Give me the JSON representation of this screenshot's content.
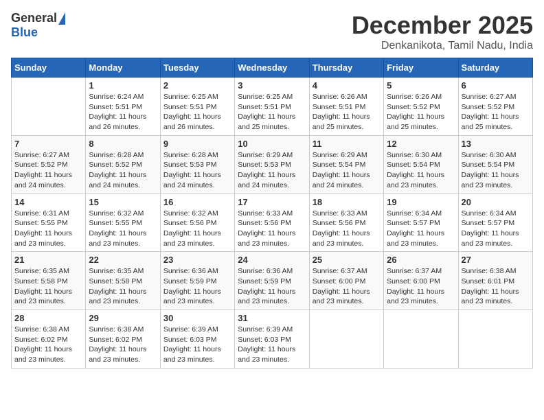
{
  "header": {
    "logo_general": "General",
    "logo_blue": "Blue",
    "month_title": "December 2025",
    "subtitle": "Denkanikota, Tamil Nadu, India"
  },
  "weekdays": [
    "Sunday",
    "Monday",
    "Tuesday",
    "Wednesday",
    "Thursday",
    "Friday",
    "Saturday"
  ],
  "weeks": [
    [
      {
        "day": "",
        "sunrise": "",
        "sunset": "",
        "daylight": ""
      },
      {
        "day": "1",
        "sunrise": "Sunrise: 6:24 AM",
        "sunset": "Sunset: 5:51 PM",
        "daylight": "Daylight: 11 hours and 26 minutes."
      },
      {
        "day": "2",
        "sunrise": "Sunrise: 6:25 AM",
        "sunset": "Sunset: 5:51 PM",
        "daylight": "Daylight: 11 hours and 26 minutes."
      },
      {
        "day": "3",
        "sunrise": "Sunrise: 6:25 AM",
        "sunset": "Sunset: 5:51 PM",
        "daylight": "Daylight: 11 hours and 25 minutes."
      },
      {
        "day": "4",
        "sunrise": "Sunrise: 6:26 AM",
        "sunset": "Sunset: 5:51 PM",
        "daylight": "Daylight: 11 hours and 25 minutes."
      },
      {
        "day": "5",
        "sunrise": "Sunrise: 6:26 AM",
        "sunset": "Sunset: 5:52 PM",
        "daylight": "Daylight: 11 hours and 25 minutes."
      },
      {
        "day": "6",
        "sunrise": "Sunrise: 6:27 AM",
        "sunset": "Sunset: 5:52 PM",
        "daylight": "Daylight: 11 hours and 25 minutes."
      }
    ],
    [
      {
        "day": "7",
        "sunrise": "Sunrise: 6:27 AM",
        "sunset": "Sunset: 5:52 PM",
        "daylight": "Daylight: 11 hours and 24 minutes."
      },
      {
        "day": "8",
        "sunrise": "Sunrise: 6:28 AM",
        "sunset": "Sunset: 5:52 PM",
        "daylight": "Daylight: 11 hours and 24 minutes."
      },
      {
        "day": "9",
        "sunrise": "Sunrise: 6:28 AM",
        "sunset": "Sunset: 5:53 PM",
        "daylight": "Daylight: 11 hours and 24 minutes."
      },
      {
        "day": "10",
        "sunrise": "Sunrise: 6:29 AM",
        "sunset": "Sunset: 5:53 PM",
        "daylight": "Daylight: 11 hours and 24 minutes."
      },
      {
        "day": "11",
        "sunrise": "Sunrise: 6:29 AM",
        "sunset": "Sunset: 5:54 PM",
        "daylight": "Daylight: 11 hours and 24 minutes."
      },
      {
        "day": "12",
        "sunrise": "Sunrise: 6:30 AM",
        "sunset": "Sunset: 5:54 PM",
        "daylight": "Daylight: 11 hours and 23 minutes."
      },
      {
        "day": "13",
        "sunrise": "Sunrise: 6:30 AM",
        "sunset": "Sunset: 5:54 PM",
        "daylight": "Daylight: 11 hours and 23 minutes."
      }
    ],
    [
      {
        "day": "14",
        "sunrise": "Sunrise: 6:31 AM",
        "sunset": "Sunset: 5:55 PM",
        "daylight": "Daylight: 11 hours and 23 minutes."
      },
      {
        "day": "15",
        "sunrise": "Sunrise: 6:32 AM",
        "sunset": "Sunset: 5:55 PM",
        "daylight": "Daylight: 11 hours and 23 minutes."
      },
      {
        "day": "16",
        "sunrise": "Sunrise: 6:32 AM",
        "sunset": "Sunset: 5:56 PM",
        "daylight": "Daylight: 11 hours and 23 minutes."
      },
      {
        "day": "17",
        "sunrise": "Sunrise: 6:33 AM",
        "sunset": "Sunset: 5:56 PM",
        "daylight": "Daylight: 11 hours and 23 minutes."
      },
      {
        "day": "18",
        "sunrise": "Sunrise: 6:33 AM",
        "sunset": "Sunset: 5:56 PM",
        "daylight": "Daylight: 11 hours and 23 minutes."
      },
      {
        "day": "19",
        "sunrise": "Sunrise: 6:34 AM",
        "sunset": "Sunset: 5:57 PM",
        "daylight": "Daylight: 11 hours and 23 minutes."
      },
      {
        "day": "20",
        "sunrise": "Sunrise: 6:34 AM",
        "sunset": "Sunset: 5:57 PM",
        "daylight": "Daylight: 11 hours and 23 minutes."
      }
    ],
    [
      {
        "day": "21",
        "sunrise": "Sunrise: 6:35 AM",
        "sunset": "Sunset: 5:58 PM",
        "daylight": "Daylight: 11 hours and 23 minutes."
      },
      {
        "day": "22",
        "sunrise": "Sunrise: 6:35 AM",
        "sunset": "Sunset: 5:58 PM",
        "daylight": "Daylight: 11 hours and 23 minutes."
      },
      {
        "day": "23",
        "sunrise": "Sunrise: 6:36 AM",
        "sunset": "Sunset: 5:59 PM",
        "daylight": "Daylight: 11 hours and 23 minutes."
      },
      {
        "day": "24",
        "sunrise": "Sunrise: 6:36 AM",
        "sunset": "Sunset: 5:59 PM",
        "daylight": "Daylight: 11 hours and 23 minutes."
      },
      {
        "day": "25",
        "sunrise": "Sunrise: 6:37 AM",
        "sunset": "Sunset: 6:00 PM",
        "daylight": "Daylight: 11 hours and 23 minutes."
      },
      {
        "day": "26",
        "sunrise": "Sunrise: 6:37 AM",
        "sunset": "Sunset: 6:00 PM",
        "daylight": "Daylight: 11 hours and 23 minutes."
      },
      {
        "day": "27",
        "sunrise": "Sunrise: 6:38 AM",
        "sunset": "Sunset: 6:01 PM",
        "daylight": "Daylight: 11 hours and 23 minutes."
      }
    ],
    [
      {
        "day": "28",
        "sunrise": "Sunrise: 6:38 AM",
        "sunset": "Sunset: 6:02 PM",
        "daylight": "Daylight: 11 hours and 23 minutes."
      },
      {
        "day": "29",
        "sunrise": "Sunrise: 6:38 AM",
        "sunset": "Sunset: 6:02 PM",
        "daylight": "Daylight: 11 hours and 23 minutes."
      },
      {
        "day": "30",
        "sunrise": "Sunrise: 6:39 AM",
        "sunset": "Sunset: 6:03 PM",
        "daylight": "Daylight: 11 hours and 23 minutes."
      },
      {
        "day": "31",
        "sunrise": "Sunrise: 6:39 AM",
        "sunset": "Sunset: 6:03 PM",
        "daylight": "Daylight: 11 hours and 23 minutes."
      },
      {
        "day": "",
        "sunrise": "",
        "sunset": "",
        "daylight": ""
      },
      {
        "day": "",
        "sunrise": "",
        "sunset": "",
        "daylight": ""
      },
      {
        "day": "",
        "sunrise": "",
        "sunset": "",
        "daylight": ""
      }
    ]
  ]
}
